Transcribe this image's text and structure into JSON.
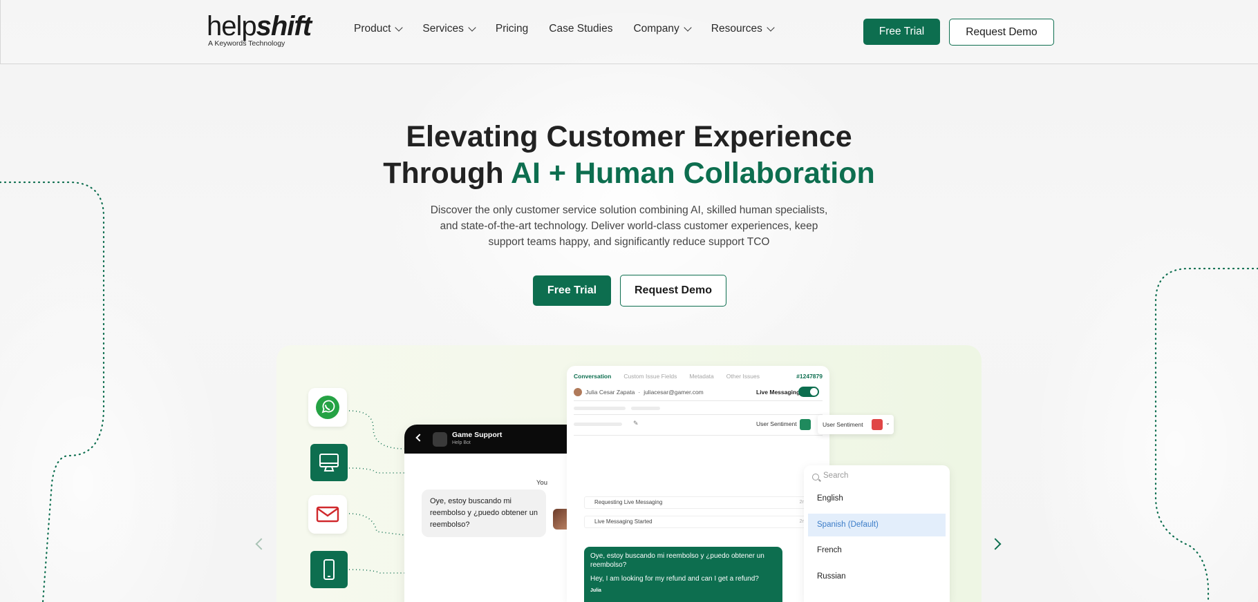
{
  "nav": {
    "logo": {
      "part1": "help",
      "part2": "shift",
      "tagline": "A Keywords Technology"
    },
    "menu": [
      {
        "label": "Product",
        "dropdown": true
      },
      {
        "label": "Services",
        "dropdown": true
      },
      {
        "label": "Pricing",
        "dropdown": false
      },
      {
        "label": "Case Studies",
        "dropdown": false
      },
      {
        "label": "Company",
        "dropdown": true
      },
      {
        "label": "Resources",
        "dropdown": true
      }
    ],
    "trial_label": "Free Trial",
    "demo_label": "Request Demo"
  },
  "hero": {
    "title_line1": "Elevating Customer Experience",
    "title_line2_plain": "Through ",
    "title_line2_accent": "AI + Human Collaboration",
    "subtitle": "Discover the only customer service solution combining AI, skilled human specialists, and state-of-the-art technology. Deliver world-class customer experiences, keep support teams happy, and significantly reduce support TCO",
    "trial_label": "Free Trial",
    "demo_label": "Request Demo"
  },
  "showcase": {
    "channels": [
      "whatsapp-icon",
      "desktop-icon",
      "mail-icon",
      "mobile-icon"
    ],
    "phone": {
      "title": "Game Support",
      "subtitle": "Help Bot",
      "you_label": "You",
      "message": "Oye, estoy buscando mi reembolso y ¿puedo obtener un reembolso?"
    },
    "console": {
      "tabs": [
        "Conversation",
        "Custom Issue Fields",
        "Metadata",
        "Other Issues"
      ],
      "ticket_id": "#1247879",
      "user_name": "Julia Cesar Zapata",
      "separator": "·",
      "user_email": "juliacesar@gamer.com",
      "live_label": "Live Messaging",
      "sentiment_label": "User Sentiment",
      "events": [
        {
          "text": "Requesting Live Messaging",
          "time": "2m ago"
        },
        {
          "text": "Live Messaging Started",
          "time": "2m ago"
        }
      ],
      "green_message": {
        "original": "Oye, estoy buscando mi reembolso y ¿puedo obtener un reembolso?",
        "translated": "Hey, I am looking for my refund and can I get a refund?",
        "sender": "Julia"
      }
    },
    "language_dropdown": {
      "search_placeholder": "Search",
      "options": [
        "English",
        "Spanish (Default)",
        "French",
        "Russian"
      ],
      "selected": "Spanish (Default)"
    }
  },
  "colors": {
    "brand_green": "#0d6e4f",
    "selected_blue": "#e3eefb",
    "sentiment_positive": "#1f8a5d",
    "sentiment_negative": "#e04646"
  }
}
